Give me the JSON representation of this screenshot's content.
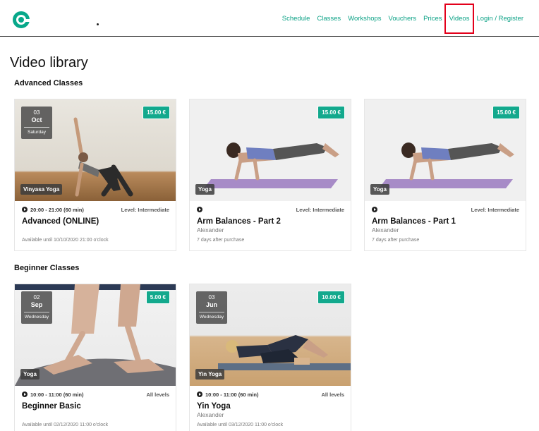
{
  "header": {
    "nav": [
      "Schedule",
      "Classes",
      "Workshops",
      "Vouchers",
      "Prices",
      "Videos",
      "Login / Register"
    ]
  },
  "page": {
    "title": "Video library"
  },
  "sections": [
    {
      "title": "Advanced Classes",
      "cards": [
        {
          "price": "15.00 €",
          "date": {
            "day": "03",
            "month": "Oct",
            "weekday": "Saturday"
          },
          "tag": "Vinyasa Yoga",
          "time": "20:00 - 21:00 (60 min)",
          "level": "Level: Intermediate",
          "title": "Advanced (ONLINE)",
          "teacher": "",
          "availability": "Available until 10/10/2020 21:00 o'clock"
        },
        {
          "price": "15.00 €",
          "tag": "Yoga",
          "time": "",
          "level": "Level: Intermediate",
          "title": "Arm Balances - Part 2",
          "teacher": "Alexander",
          "availability": "7 days after purchase"
        },
        {
          "price": "15.00 €",
          "tag": "Yoga",
          "time": "",
          "level": "Level: Intermediate",
          "title": "Arm Balances - Part 1",
          "teacher": "Alexander",
          "availability": "7 days after purchase"
        }
      ]
    },
    {
      "title": "Beginner Classes",
      "cards": [
        {
          "price": "5.00 €",
          "date": {
            "day": "02",
            "month": "Sep",
            "weekday": "Wednesday"
          },
          "tag": "Yoga",
          "time": "10:00 - 11:00 (60 min)",
          "level": "All levels",
          "title": "Beginner Basic",
          "teacher": "",
          "availability": "Available until 02/12/2020 11:00 o'clock"
        },
        {
          "price": "10.00 €",
          "date": {
            "day": "03",
            "month": "Jun",
            "weekday": "Wednesday"
          },
          "tag": "Yin Yoga",
          "time": "10:00 - 11:00 (60 min)",
          "level": "All levels",
          "title": "Yin Yoga",
          "teacher": "Alexander",
          "availability": "Available until 03/12/2020 11:00 o'clock"
        }
      ]
    }
  ],
  "colors": {
    "accent": "#0aa185",
    "price_badge": "#13a98d",
    "highlight": "#e3001b"
  }
}
